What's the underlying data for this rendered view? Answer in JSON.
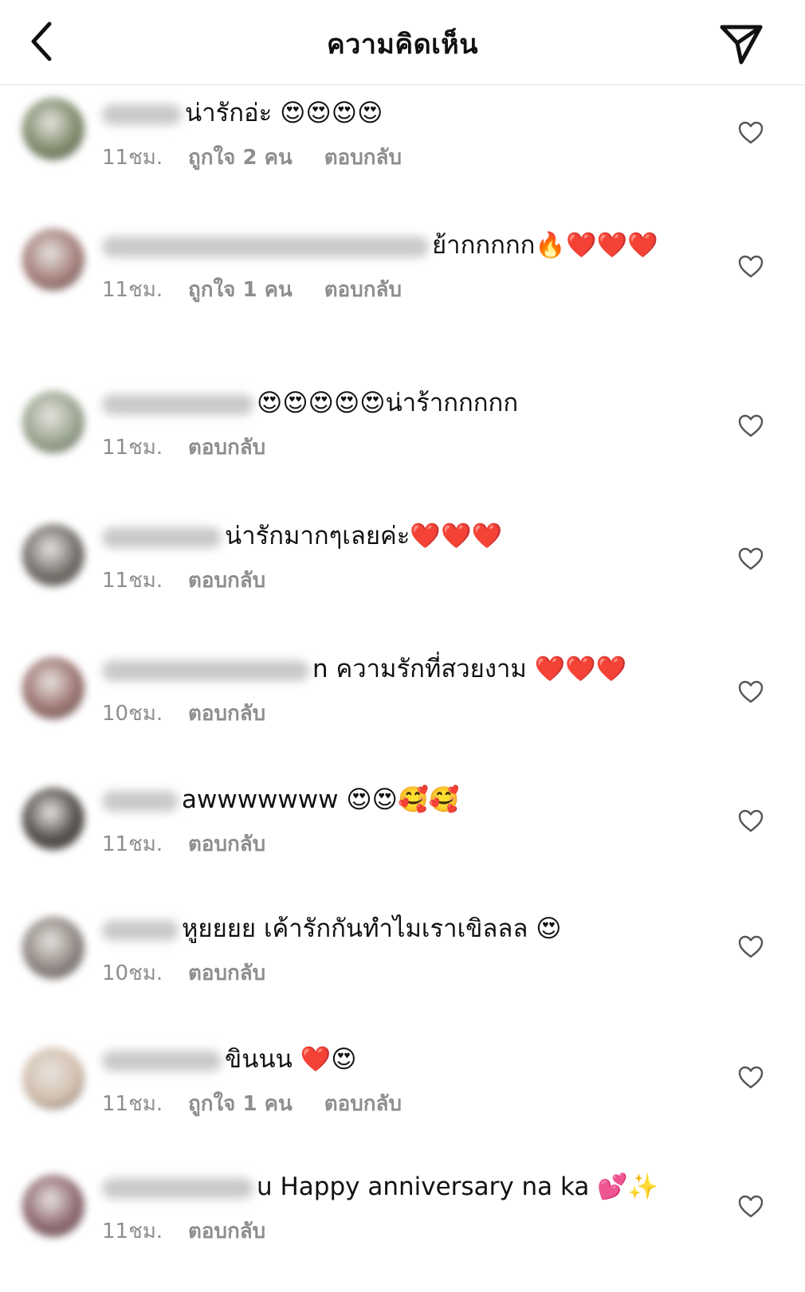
{
  "header": {
    "title": "ความคิดเห็น",
    "back_icon": "chevron-left-icon",
    "share_icon": "paper-plane-icon"
  },
  "colors": {
    "text": "#111111",
    "meta": "#8e8e8e",
    "divider": "#e4e4e4"
  },
  "comments": [
    {
      "text": "น่ารักอ่ะ 😍😍😍😍",
      "time": "11ชม.",
      "likes": "ถูกใจ 2 คน",
      "reply": "ตอบกลับ",
      "avatar_color": "#7d8a6a",
      "like_icon": "heart-outline-icon"
    },
    {
      "text": "ย้ากกกกก🔥❤️❤️❤️",
      "time": "11ชม.",
      "likes": "ถูกใจ 1 คน",
      "reply": "ตอบกลับ",
      "avatar_color": "#a37d79",
      "like_icon": "heart-outline-icon"
    },
    {
      "text": "😍😍😍😍😍น่าร้ากกกกก",
      "time": "11ชม.",
      "likes": "",
      "reply": "ตอบกลับ",
      "avatar_color": "#98a48e",
      "like_icon": "heart-outline-icon"
    },
    {
      "text": "น่ารักมากๆเลยค่ะ❤️❤️❤️",
      "time": "11ชม.",
      "likes": "",
      "reply": "ตอบกลับ",
      "avatar_color": "#6f6b66",
      "like_icon": "heart-outline-icon"
    },
    {
      "text": "n ความรักที่สวยงาม ❤️❤️❤️",
      "time": "10ชม.",
      "likes": "",
      "reply": "ตอบกลับ",
      "avatar_color": "#9a716e",
      "like_icon": "heart-outline-icon"
    },
    {
      "text": "awwwwwww 😍😍🥰🥰",
      "time": "11ชม.",
      "likes": "",
      "reply": "ตอบกลับ",
      "avatar_color": "#4f4b47",
      "like_icon": "heart-outline-icon"
    },
    {
      "text": "หูยยยย เค้ารักกันทำไมเราเขิลลล 😍",
      "time": "10ชม.",
      "likes": "",
      "reply": "ตอบกลับ",
      "avatar_color": "#8c8480",
      "like_icon": "heart-outline-icon"
    },
    {
      "text": "ขินนน ❤️😍",
      "time": "11ชม.",
      "likes": "ถูกใจ 1 คน",
      "reply": "ตอบกลับ",
      "avatar_color": "#d3bfae",
      "like_icon": "heart-outline-icon"
    },
    {
      "text": "u Happy anniversary na ka 💕✨",
      "time": "11ชม.",
      "likes": "",
      "reply": "ตอบกลับ",
      "avatar_color": "#8e6770",
      "like_icon": "heart-outline-icon"
    }
  ]
}
